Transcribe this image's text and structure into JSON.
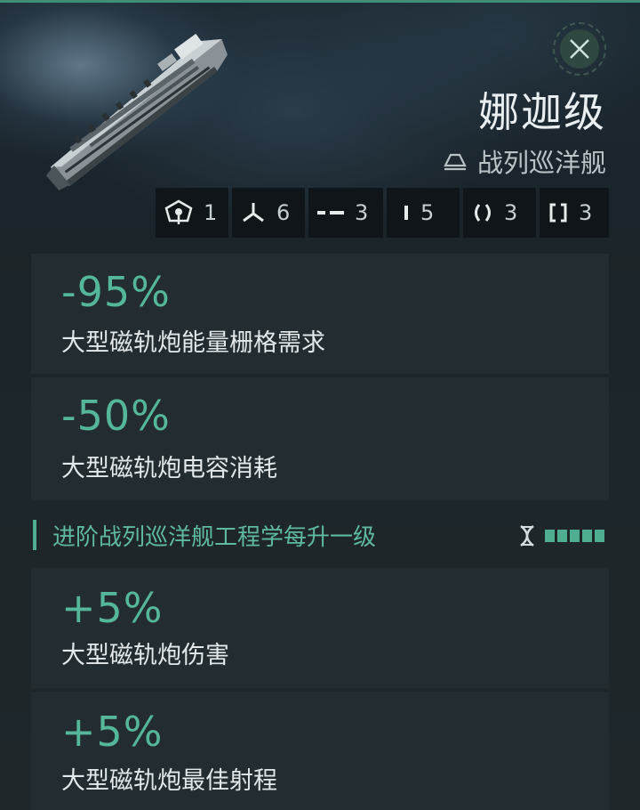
{
  "header": {
    "ship_name": "娜迦级",
    "ship_class": "战列巡洋舰",
    "class_icon": "cruiser-hull-icon",
    "close_icon": "close-icon"
  },
  "slots": [
    {
      "icon": "drone-bay-icon",
      "value": "1"
    },
    {
      "icon": "turret-hardpoint-icon",
      "value": "6"
    },
    {
      "icon": "low-slot-icon",
      "value": "3"
    },
    {
      "icon": "high-slot-icon",
      "value": "5"
    },
    {
      "icon": "mid-slot-icon",
      "value": "3"
    },
    {
      "icon": "rig-slot-icon",
      "value": "3"
    }
  ],
  "role_bonuses": [
    {
      "value": "-95%",
      "label": "大型磁轨炮能量栅格需求"
    },
    {
      "value": "-50%",
      "label": "大型磁轨炮电容消耗"
    }
  ],
  "skill_section": {
    "title": "进阶战列巡洋舰工程学每升一级",
    "icon": "skill-dna-icon",
    "level_pips": 5
  },
  "skill_bonuses": [
    {
      "value": "+5%",
      "label": "大型磁轨炮伤害"
    },
    {
      "value": "+5%",
      "label": "大型磁轨炮最佳射程"
    }
  ],
  "colors": {
    "accent": "#55b79a",
    "panel": "#232d31",
    "background": "#1b2328"
  }
}
